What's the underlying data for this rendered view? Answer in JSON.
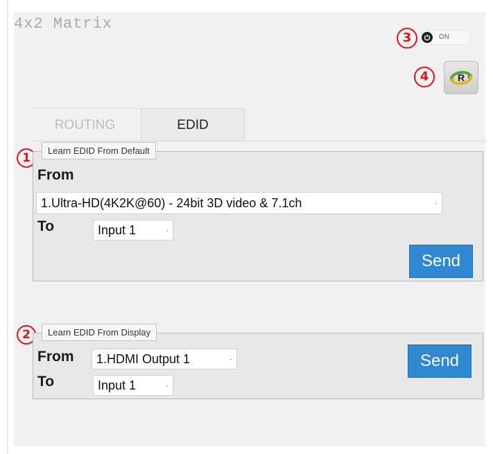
{
  "app": {
    "title": "4x2 Matrix"
  },
  "markers": {
    "one": "1",
    "two": "2",
    "three": "3",
    "four": "4"
  },
  "power": {
    "label": "ON"
  },
  "refresh": {
    "icon": "R"
  },
  "tabs": [
    {
      "label": "ROUTING",
      "active": false
    },
    {
      "label": "EDID",
      "active": true
    }
  ],
  "learn_default": {
    "legend": "Learn EDID From Default",
    "from_label": "From",
    "from_value": "1.Ultra-HD(4K2K@60) - 24bit 3D video & 7.1ch",
    "to_label": "To",
    "to_value": "Input 1",
    "send_label": "Send"
  },
  "learn_display": {
    "legend": "Learn EDID From Display",
    "from_label": "From",
    "from_value": "1.HDMI Output 1",
    "to_label": "To",
    "to_value": "Input 1",
    "send_label": "Send"
  },
  "colors": {
    "accent": "#2f88d1",
    "marker": "#e0141e",
    "panel": "#f1f1f1"
  },
  "icons": {
    "power": "power-icon",
    "refresh": "refresh-icon",
    "dropdown": "dropdown-dot-icon"
  }
}
